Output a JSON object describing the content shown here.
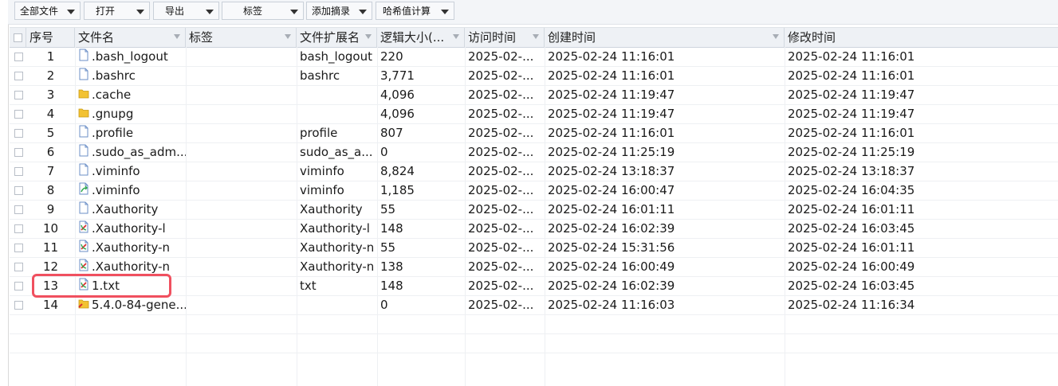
{
  "toolbar": {
    "all_files": "全部文件",
    "open": "打开",
    "export": "导出",
    "tags": "标签",
    "add_digest": "添加摘录",
    "hash_calc": "哈希值计算"
  },
  "columns": {
    "index": "序号",
    "filename": "文件名",
    "tag": "标签",
    "extension": "文件扩展名",
    "size": "逻辑大小(...",
    "accessed": "访问时间",
    "created": "创建时间",
    "modified": "修改时间"
  },
  "rows": [
    {
      "index": "1",
      "icon": "file-icon",
      "name": ".bash_logout",
      "ext": "bash_logout",
      "size": "220",
      "accessed": "2025-02-...",
      "created": "2025-02-24 11:16:01",
      "modified": "2025-02-24 11:16:01"
    },
    {
      "index": "2",
      "icon": "file-icon",
      "name": ".bashrc",
      "ext": "bashrc",
      "size": "3,771",
      "accessed": "2025-02-...",
      "created": "2025-02-24 11:16:01",
      "modified": "2025-02-24 11:16:01"
    },
    {
      "index": "3",
      "icon": "folder-icon",
      "name": ".cache",
      "ext": "",
      "size": "4,096",
      "accessed": "2025-02-...",
      "created": "2025-02-24 11:19:47",
      "modified": "2025-02-24 11:19:47"
    },
    {
      "index": "4",
      "icon": "folder-icon",
      "name": ".gnupg",
      "ext": "",
      "size": "4,096",
      "accessed": "2025-02-...",
      "created": "2025-02-24 11:19:47",
      "modified": "2025-02-24 11:19:47"
    },
    {
      "index": "5",
      "icon": "file-icon",
      "name": ".profile",
      "ext": "profile",
      "size": "807",
      "accessed": "2025-02-...",
      "created": "2025-02-24 11:16:01",
      "modified": "2025-02-24 11:16:01"
    },
    {
      "index": "6",
      "icon": "file-icon",
      "name": ".sudo_as_adm...",
      "ext": "sudo_as_a...",
      "size": "0",
      "accessed": "2025-02-...",
      "created": "2025-02-24 11:25:19",
      "modified": "2025-02-24 11:25:19"
    },
    {
      "index": "7",
      "icon": "file-icon",
      "name": ".viminfo",
      "ext": "viminfo",
      "size": "8,824",
      "accessed": "2025-02-...",
      "created": "2025-02-24 13:18:37",
      "modified": "2025-02-24 13:18:37"
    },
    {
      "index": "8",
      "icon": "modified-file-icon",
      "name": ".viminfo",
      "ext": "viminfo",
      "size": "1,185",
      "accessed": "2025-02-...",
      "created": "2025-02-24 16:00:47",
      "modified": "2025-02-24 16:04:35"
    },
    {
      "index": "9",
      "icon": "file-icon",
      "name": ".Xauthority",
      "ext": "Xauthority",
      "size": "55",
      "accessed": "2025-02-...",
      "created": "2025-02-24 16:01:11",
      "modified": "2025-02-24 16:01:11"
    },
    {
      "index": "10",
      "icon": "deleted-file-icon",
      "name": ".Xauthority-l",
      "ext": "Xauthority-l",
      "size": "148",
      "accessed": "2025-02-...",
      "created": "2025-02-24 16:02:39",
      "modified": "2025-02-24 16:03:45"
    },
    {
      "index": "11",
      "icon": "deleted-file-icon",
      "name": ".Xauthority-n",
      "ext": "Xauthority-n",
      "size": "55",
      "accessed": "2025-02-...",
      "created": "2025-02-24 15:31:56",
      "modified": "2025-02-24 16:01:11"
    },
    {
      "index": "12",
      "icon": "deleted-file-icon",
      "name": ".Xauthority-n",
      "ext": "Xauthority-n",
      "size": "138",
      "accessed": "2025-02-...",
      "created": "2025-02-24 16:00:49",
      "modified": "2025-02-24 16:00:49"
    },
    {
      "index": "13",
      "icon": "deleted-file-icon",
      "name": "1.txt",
      "ext": "txt",
      "size": "148",
      "accessed": "2025-02-...",
      "created": "2025-02-24 16:02:39",
      "modified": "2025-02-24 16:03:45"
    },
    {
      "index": "14",
      "icon": "deleted-folder-icon",
      "name": "5.4.0-84-gene...",
      "ext": "",
      "size": "0",
      "accessed": "2025-02-...",
      "created": "2025-02-24 11:16:03",
      "modified": "2025-02-24 11:16:34"
    }
  ],
  "colors": {
    "highlight": "#f0505f",
    "folder": "#f2c232",
    "file_outline": "#6b8fc7"
  }
}
